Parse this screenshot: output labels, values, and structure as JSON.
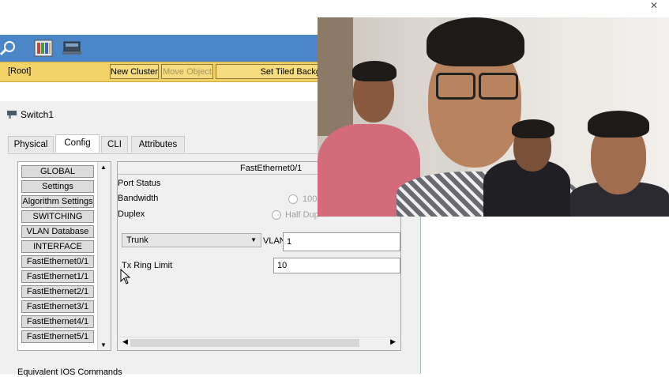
{
  "toolbar": {
    "icons": [
      "zoom-icon",
      "palette-icon",
      "custom-device-icon"
    ]
  },
  "workspace_bar": {
    "root_label": "[Root]",
    "new_cluster": "New Cluster",
    "move_object": "Move Object",
    "set_tiled_background": "Set Tiled Backg"
  },
  "window": {
    "title": "Switch1",
    "tabs": [
      "Physical",
      "Config",
      "CLI",
      "Attributes"
    ],
    "active_tab": "Config",
    "left_list": [
      "GLOBAL",
      "Settings",
      "Algorithm Settings",
      "SWITCHING",
      "VLAN Database",
      "INTERFACE",
      "FastEthernet0/1",
      "FastEthernet1/1",
      "FastEthernet2/1",
      "FastEthernet3/1",
      "FastEthernet4/1",
      "FastEthernet5/1"
    ],
    "panel_title": "FastEthernet0/1",
    "port_status_label": "Port Status",
    "bandwidth_label": "Bandwidth",
    "bandwidth_option": "100",
    "duplex_label": "Duplex",
    "duplex_option": "Half Dup",
    "mode_value": "Trunk",
    "vlan_label": "VLAN",
    "vlan_value": "1",
    "tx_ring_label": "Tx Ring Limit",
    "tx_ring_value": "10",
    "equivalent_ios": "Equivalent IOS Commands"
  },
  "colors": {
    "toolbar_blue": "#4a86c8",
    "workspace_yellow": "#f3d267"
  }
}
